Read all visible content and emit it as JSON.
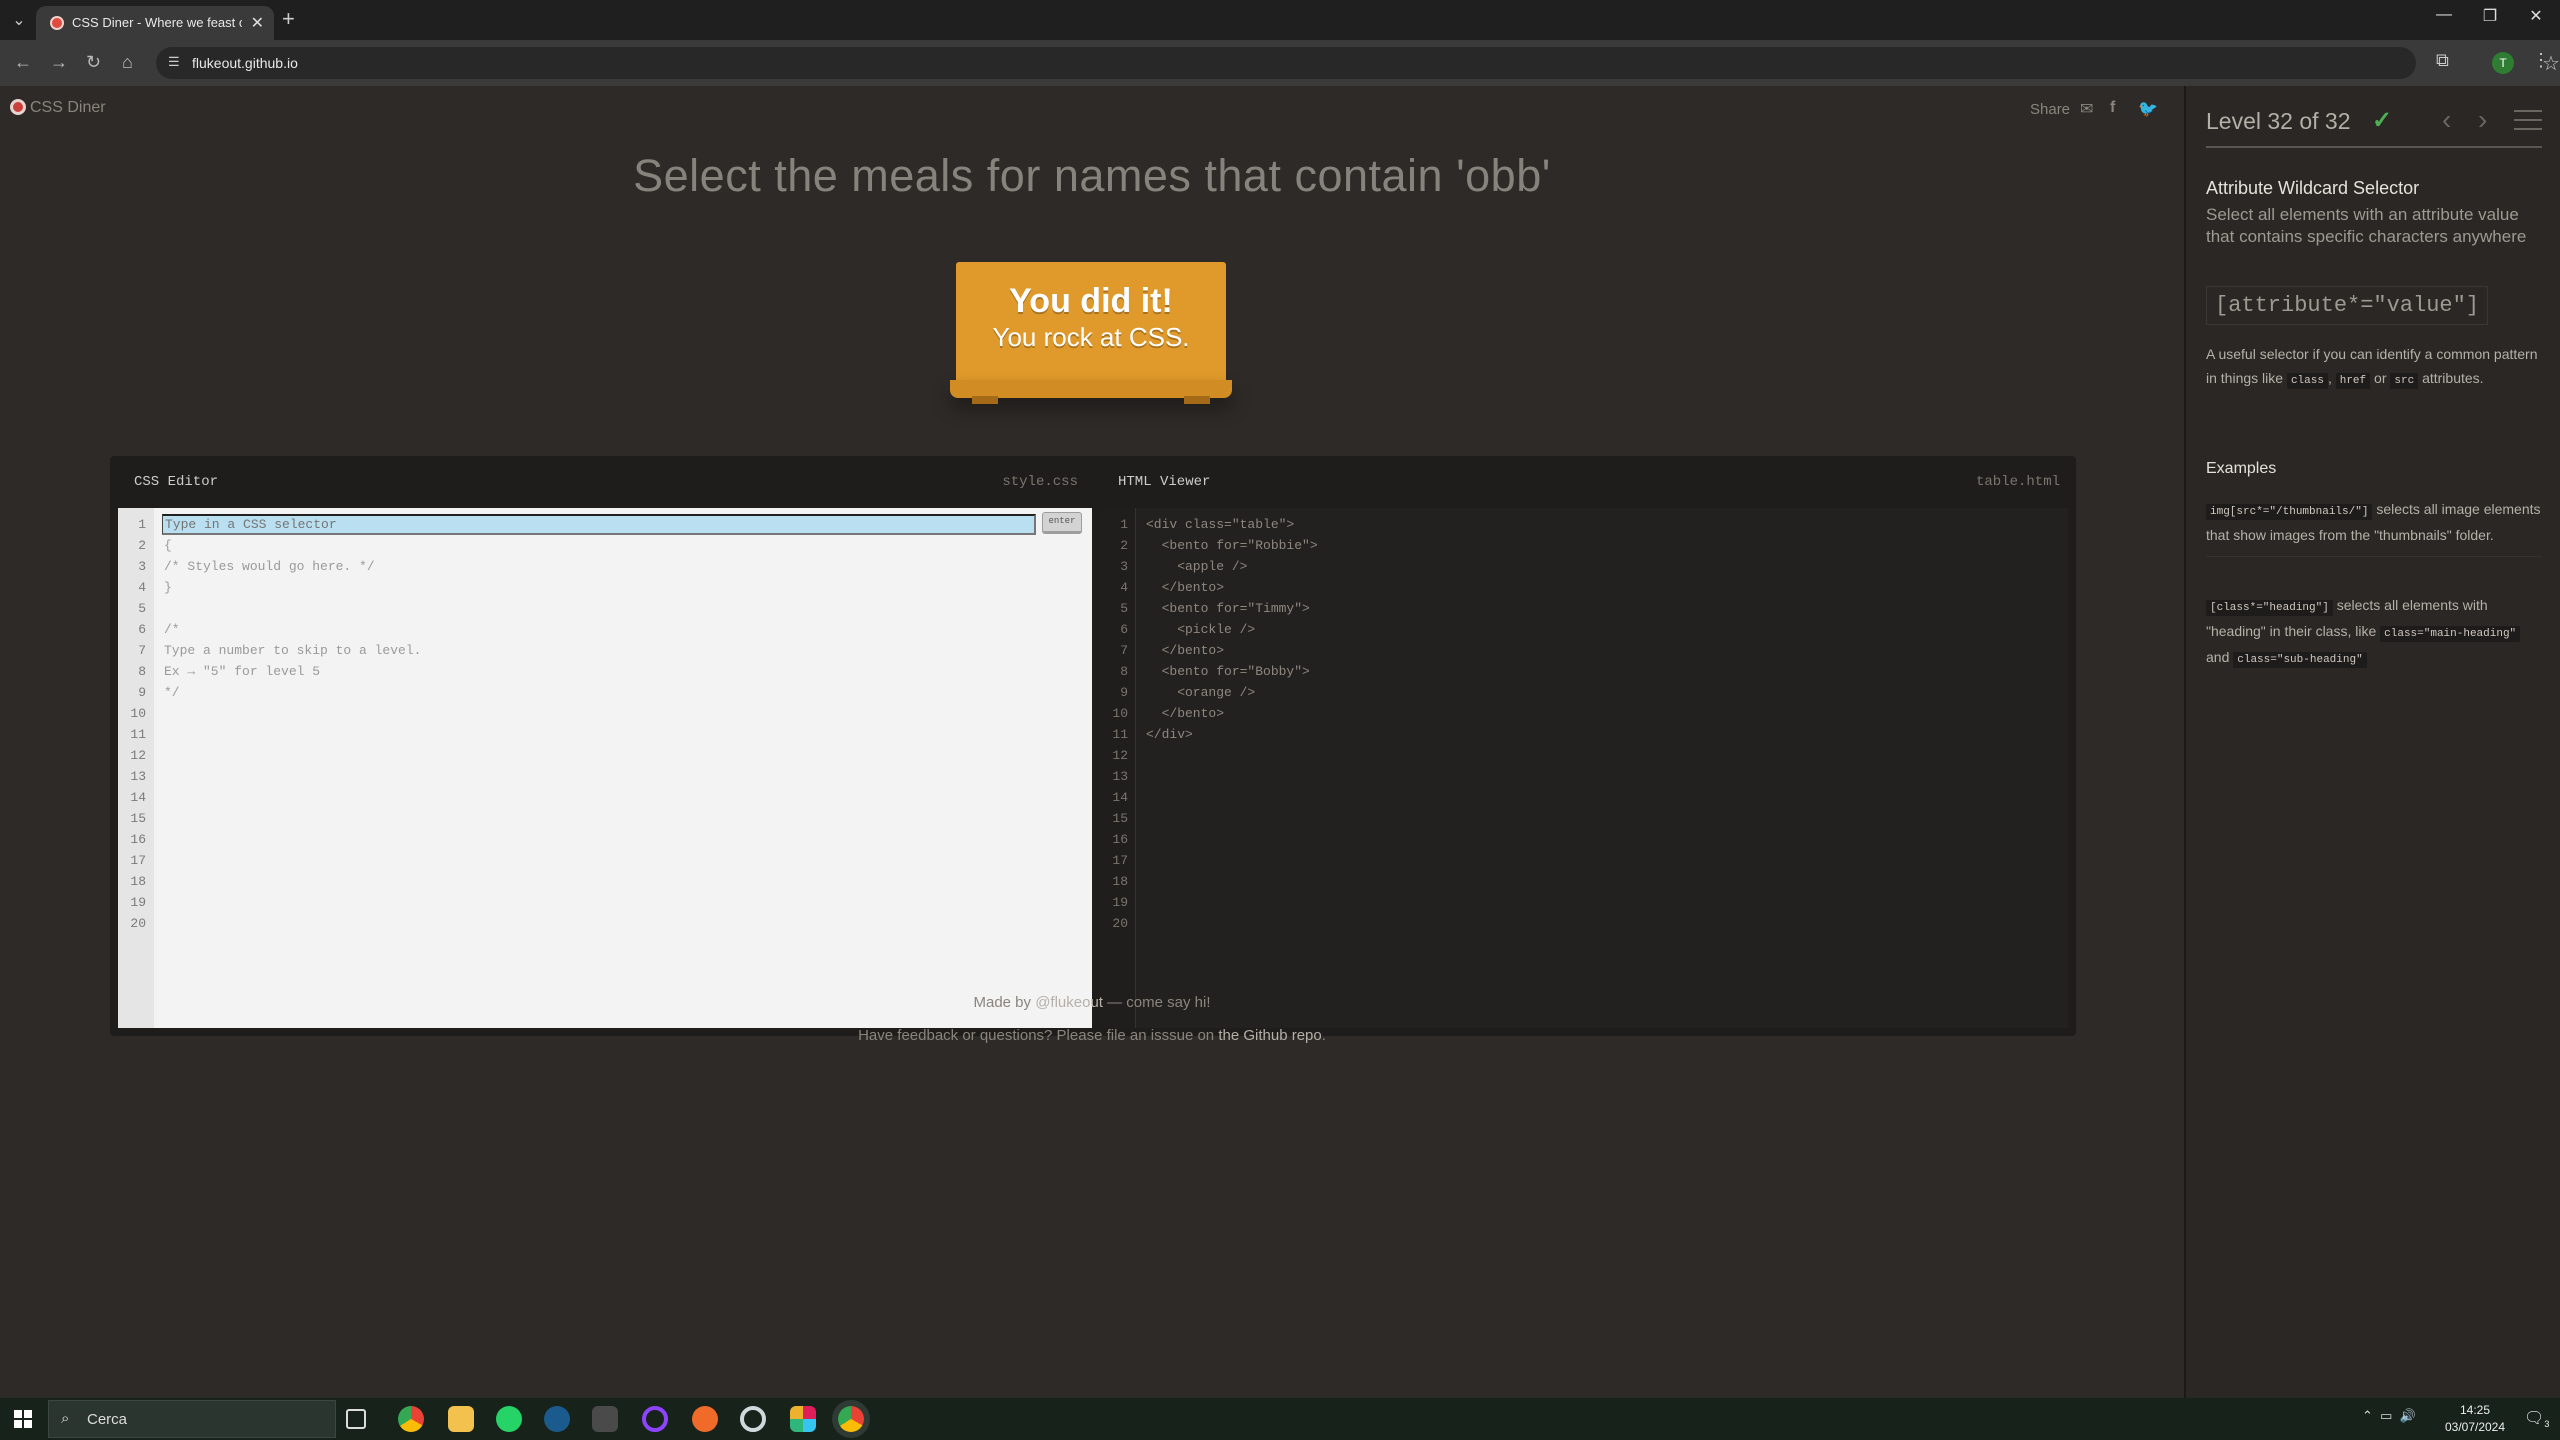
{
  "browser": {
    "tab_title": "CSS Diner - Where we feast on",
    "tab_close": "✕",
    "new_tab": "+",
    "url": "flukeout.github.io",
    "profile_initial": "T",
    "window_controls": [
      "—",
      "❐",
      "✕"
    ]
  },
  "page": {
    "logo_text": "CSS Diner",
    "share_label": "Share",
    "order": "Select the meals for names that contain 'obb'",
    "win_title": "You did it!",
    "win_subtitle": "You rock at CSS."
  },
  "css_editor": {
    "title": "CSS Editor",
    "file": "style.css",
    "input_placeholder": "Type in a CSS selector",
    "enter_label": "enter",
    "line_numbers": [
      "1",
      "2",
      "3",
      "4",
      "5",
      "6",
      "7",
      "8",
      "9",
      "10",
      "11",
      "12",
      "13",
      "14",
      "15",
      "16",
      "17",
      "18",
      "19",
      "20"
    ],
    "code_lines": [
      "",
      "{",
      "/* Styles would go here. */",
      "}",
      "",
      "/*",
      "Type a number to skip to a level.",
      "Ex → \"5\" for level 5",
      "*/"
    ]
  },
  "html_viewer": {
    "title": "HTML Viewer",
    "file": "table.html",
    "line_numbers": [
      "1",
      "2",
      "3",
      "4",
      "5",
      "6",
      "7",
      "8",
      "9",
      "10",
      "11",
      "12",
      "13",
      "14",
      "15",
      "16",
      "17",
      "18",
      "19",
      "20"
    ],
    "code_lines": [
      "<div class=\"table\">",
      "  <bento for=\"Robbie\">",
      "    <apple />",
      "  </bento>",
      "  <bento for=\"Timmy\">",
      "    <pickle />",
      "  </bento>",
      "  <bento for=\"Bobby\">",
      "    <orange />",
      "  </bento>",
      "</div>"
    ]
  },
  "credits": {
    "made_by": "Made by",
    "author": "@flukeout",
    "made_by_suffix": "— come say hi!",
    "feedback": "Have feedback or questions? Please file an isssue on",
    "repo_link": "the Github repo",
    "period": "."
  },
  "sidebar": {
    "level_text": "Level 32 of 32",
    "progress": 1.0,
    "selector_name": "Attribute Wildcard Selector",
    "selector_title": "Select all elements with an attribute value that contains specific characters anywhere",
    "syntax": "[attribute*=\"value\"]",
    "hint_1": "A useful selector if you can identify a common pattern in things like",
    "hint_chip_1": "class",
    "hint_sep_1": ",",
    "hint_chip_2": "href",
    "hint_sep_2": "or",
    "hint_chip_3": "src",
    "hint_2": "attributes.",
    "examples_title": "Examples",
    "example_1_chip": "img[src*=\"/thumbnails/\"]",
    "example_1_text": "selects all image elements that show images from the \"thumbnails\" folder.",
    "example_2_chip": "[class*=\"heading\"]",
    "example_2_text": "selects all elements with \"heading\" in their class, like",
    "example_2_chip_2": "class=\"main-heading\"",
    "example_2_and": "and",
    "example_2_chip_3": "class=\"sub-heading\""
  },
  "taskbar": {
    "search_placeholder": "Cerca",
    "time": "14:25",
    "date": "03/07/2024",
    "notification_count": "3"
  },
  "colors": {
    "page_bg": "#2d2a27",
    "table": "#e09a2b",
    "check": "#4caf50",
    "input_highlight": "#b9dff0"
  }
}
